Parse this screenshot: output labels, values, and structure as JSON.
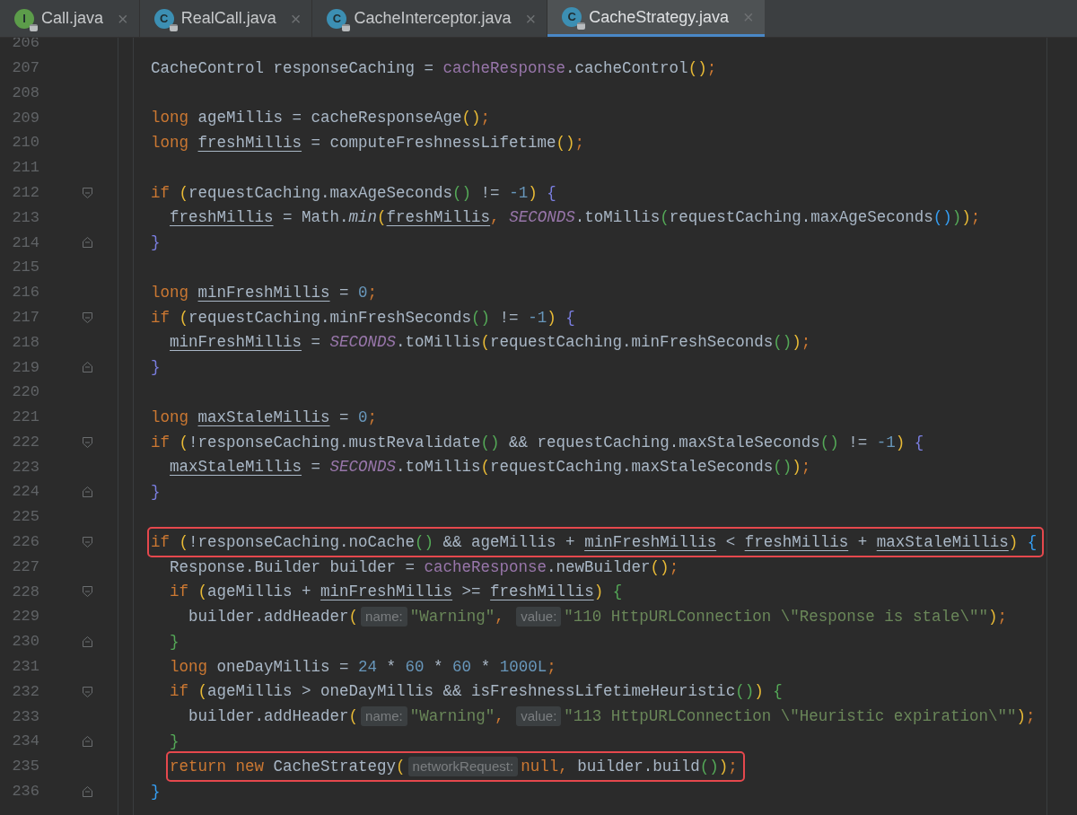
{
  "tabs": [
    {
      "interface": true,
      "icon_letter": "I",
      "label": "Call.java",
      "close": "×",
      "selected": false
    },
    {
      "interface": false,
      "icon_letter": "C",
      "label": "RealCall.java",
      "close": "×",
      "selected": false
    },
    {
      "interface": false,
      "icon_letter": "C",
      "label": "CacheInterceptor.java",
      "close": "×",
      "selected": false
    },
    {
      "interface": false,
      "icon_letter": "C",
      "label": "CacheStrategy.java",
      "close": "×",
      "selected": true
    }
  ],
  "lines": [
    {
      "number": "206"
    },
    {
      "number": "207",
      "tokens": [
        {
          "kind": "plain",
          "text": "CacheControl responseCaching = "
        },
        {
          "kind": "field",
          "text": "cacheResponse"
        },
        {
          "kind": "plain",
          "text": ".cacheControl"
        },
        {
          "kind": "b1",
          "text": "()"
        },
        {
          "kind": "punct",
          "text": ";"
        }
      ]
    },
    {
      "number": "208"
    },
    {
      "number": "209",
      "tokens": [
        {
          "kind": "kw",
          "text": "long "
        },
        {
          "kind": "plain",
          "text": "ageMillis = cacheResponseAge"
        },
        {
          "kind": "b1",
          "text": "()"
        },
        {
          "kind": "punct",
          "text": ";"
        }
      ]
    },
    {
      "number": "210",
      "tokens": [
        {
          "kind": "kw",
          "text": "long "
        },
        {
          "kind": "var",
          "text": "freshMillis"
        },
        {
          "kind": "plain",
          "text": " = computeFreshnessLifetime"
        },
        {
          "kind": "b1",
          "text": "()"
        },
        {
          "kind": "punct",
          "text": ";"
        }
      ]
    },
    {
      "number": "211"
    },
    {
      "number": "212",
      "fold_start": true,
      "tokens": [
        {
          "kind": "kw",
          "text": "if "
        },
        {
          "kind": "b1",
          "text": "("
        },
        {
          "kind": "plain",
          "text": "requestCaching.maxAgeSeconds"
        },
        {
          "kind": "b2",
          "text": "()"
        },
        {
          "kind": "plain",
          "text": " != "
        },
        {
          "kind": "num",
          "text": "-1"
        },
        {
          "kind": "b1",
          "text": ")"
        },
        {
          "kind": "b4",
          "text": " {"
        }
      ],
      "children": [
        {
          "number": "213",
          "tokens": [
            {
              "kind": "var",
              "text": "freshMillis"
            },
            {
              "kind": "plain",
              "text": " = Math."
            },
            {
              "kind": "static_call",
              "text": "min"
            },
            {
              "kind": "b1",
              "text": "("
            },
            {
              "kind": "var",
              "text": "freshMillis"
            },
            {
              "kind": "punct",
              "text": ", "
            },
            {
              "kind": "const",
              "text": "SECONDS"
            },
            {
              "kind": "plain",
              "text": ".toMillis"
            },
            {
              "kind": "b2",
              "text": "("
            },
            {
              "kind": "plain",
              "text": "requestCaching.maxAgeSeconds"
            },
            {
              "kind": "b3",
              "text": "()"
            },
            {
              "kind": "b2",
              "text": ")"
            },
            {
              "kind": "b1",
              "text": ")"
            },
            {
              "kind": "punct",
              "text": ";"
            }
          ]
        }
      ]
    },
    {
      "number": "214",
      "fold_end": true,
      "tokens": [
        {
          "kind": "b4",
          "text": "}"
        }
      ]
    },
    {
      "number": "215"
    },
    {
      "number": "216",
      "tokens": [
        {
          "kind": "kw",
          "text": "long "
        },
        {
          "kind": "var",
          "text": "minFreshMillis"
        },
        {
          "kind": "plain",
          "text": " = "
        },
        {
          "kind": "num",
          "text": "0"
        },
        {
          "kind": "punct",
          "text": ";"
        }
      ]
    },
    {
      "number": "217",
      "fold_start": true,
      "tokens": [
        {
          "kind": "kw",
          "text": "if "
        },
        {
          "kind": "b1",
          "text": "("
        },
        {
          "kind": "plain",
          "text": "requestCaching.minFreshSeconds"
        },
        {
          "kind": "b2",
          "text": "()"
        },
        {
          "kind": "plain",
          "text": " != "
        },
        {
          "kind": "num",
          "text": "-1"
        },
        {
          "kind": "b1",
          "text": ")"
        },
        {
          "kind": "b4",
          "text": " {"
        }
      ],
      "children": [
        {
          "number": "218",
          "tokens": [
            {
              "kind": "var",
              "text": "minFreshMillis"
            },
            {
              "kind": "plain",
              "text": " = "
            },
            {
              "kind": "const",
              "text": "SECONDS"
            },
            {
              "kind": "plain",
              "text": ".toMillis"
            },
            {
              "kind": "b1",
              "text": "("
            },
            {
              "kind": "plain",
              "text": "requestCaching.minFreshSeconds"
            },
            {
              "kind": "b2",
              "text": "()"
            },
            {
              "kind": "b1",
              "text": ")"
            },
            {
              "kind": "punct",
              "text": ";"
            }
          ]
        }
      ]
    },
    {
      "number": "219",
      "fold_end": true,
      "tokens": [
        {
          "kind": "b4",
          "text": "}"
        }
      ]
    },
    {
      "number": "220"
    },
    {
      "number": "221",
      "tokens": [
        {
          "kind": "kw",
          "text": "long "
        },
        {
          "kind": "var",
          "text": "maxStaleMillis"
        },
        {
          "kind": "plain",
          "text": " = "
        },
        {
          "kind": "num",
          "text": "0"
        },
        {
          "kind": "punct",
          "text": ";"
        }
      ]
    },
    {
      "number": "222",
      "fold_start": true,
      "tokens": [
        {
          "kind": "kw",
          "text": "if "
        },
        {
          "kind": "b1",
          "text": "("
        },
        {
          "kind": "plain",
          "text": "!responseCaching.mustRevalidate"
        },
        {
          "kind": "b2",
          "text": "()"
        },
        {
          "kind": "plain",
          "text": " && requestCaching.maxStaleSeconds"
        },
        {
          "kind": "b2",
          "text": "()"
        },
        {
          "kind": "plain",
          "text": " != "
        },
        {
          "kind": "num",
          "text": "-1"
        },
        {
          "kind": "b1",
          "text": ")"
        },
        {
          "kind": "b4",
          "text": " {"
        }
      ],
      "children": [
        {
          "number": "223",
          "tokens": [
            {
              "kind": "var",
              "text": "maxStaleMillis"
            },
            {
              "kind": "plain",
              "text": " = "
            },
            {
              "kind": "const",
              "text": "SECONDS"
            },
            {
              "kind": "plain",
              "text": ".toMillis"
            },
            {
              "kind": "b1",
              "text": "("
            },
            {
              "kind": "plain",
              "text": "requestCaching.maxStaleSeconds"
            },
            {
              "kind": "b2",
              "text": "()"
            },
            {
              "kind": "b1",
              "text": ")"
            },
            {
              "kind": "punct",
              "text": ";"
            }
          ]
        }
      ]
    },
    {
      "number": "224",
      "fold_end": true,
      "tokens": [
        {
          "kind": "b4",
          "text": "}"
        }
      ]
    },
    {
      "number": "225"
    },
    {
      "number": "226",
      "fold_start": true,
      "highlighted": true,
      "tokens": [
        {
          "kind": "kw",
          "text": "if "
        },
        {
          "kind": "b1",
          "text": "("
        },
        {
          "kind": "plain",
          "text": "!responseCaching.noCache"
        },
        {
          "kind": "b2",
          "text": "()"
        },
        {
          "kind": "plain",
          "text": " && ageMillis + "
        },
        {
          "kind": "var",
          "text": "minFreshMillis"
        },
        {
          "kind": "plain",
          "text": " < "
        },
        {
          "kind": "var",
          "text": "freshMillis"
        },
        {
          "kind": "plain",
          "text": " + "
        },
        {
          "kind": "var",
          "text": "maxStaleMillis"
        },
        {
          "kind": "b1",
          "text": ")"
        },
        {
          "kind": "b3",
          "text": " {"
        }
      ],
      "children": [
        {
          "number": "227",
          "tokens": [
            {
              "kind": "plain",
              "text": "Response.Builder builder = "
            },
            {
              "kind": "field",
              "text": "cacheResponse"
            },
            {
              "kind": "plain",
              "text": ".newBuilder"
            },
            {
              "kind": "b1",
              "text": "()"
            },
            {
              "kind": "punct",
              "text": ";"
            }
          ]
        },
        {
          "number": "228",
          "fold_start": true,
          "tokens": [
            {
              "kind": "kw",
              "text": "if "
            },
            {
              "kind": "b1",
              "text": "("
            },
            {
              "kind": "plain",
              "text": "ageMillis + "
            },
            {
              "kind": "var",
              "text": "minFreshMillis"
            },
            {
              "kind": "plain",
              "text": " >= "
            },
            {
              "kind": "var",
              "text": "freshMillis"
            },
            {
              "kind": "b1",
              "text": ")"
            },
            {
              "kind": "b2",
              "text": " {"
            }
          ],
          "children": [
            {
              "number": "229",
              "tokens": [
                {
                  "kind": "plain",
                  "text": "builder.addHeader"
                },
                {
                  "kind": "b1",
                  "text": "("
                },
                {
                  "kind": "hint",
                  "text": "name:"
                },
                {
                  "kind": "str",
                  "text": "\"Warning\""
                },
                {
                  "kind": "punct",
                  "text": ", "
                },
                {
                  "kind": "hint",
                  "text": "value:"
                },
                {
                  "kind": "str",
                  "text": "\"110 HttpURLConnection \\\"Response is stale\\\"\""
                },
                {
                  "kind": "b1",
                  "text": ")"
                },
                {
                  "kind": "punct",
                  "text": ";"
                }
              ]
            }
          ]
        },
        {
          "number": "230",
          "fold_end": true,
          "tokens": [
            {
              "kind": "b2",
              "text": "}"
            }
          ]
        },
        {
          "number": "231",
          "tokens": [
            {
              "kind": "kw",
              "text": "long "
            },
            {
              "kind": "plain",
              "text": "oneDayMillis = "
            },
            {
              "kind": "num",
              "text": "24"
            },
            {
              "kind": "plain",
              "text": " * "
            },
            {
              "kind": "num",
              "text": "60"
            },
            {
              "kind": "plain",
              "text": " * "
            },
            {
              "kind": "num",
              "text": "60"
            },
            {
              "kind": "plain",
              "text": " * "
            },
            {
              "kind": "num",
              "text": "1000L"
            },
            {
              "kind": "punct",
              "text": ";"
            }
          ]
        },
        {
          "number": "232",
          "fold_start": true,
          "tokens": [
            {
              "kind": "kw",
              "text": "if "
            },
            {
              "kind": "b1",
              "text": "("
            },
            {
              "kind": "plain",
              "text": "ageMillis > oneDayMillis && isFreshnessLifetimeHeuristic"
            },
            {
              "kind": "b2",
              "text": "()"
            },
            {
              "kind": "b1",
              "text": ")"
            },
            {
              "kind": "b2",
              "text": " {"
            }
          ],
          "children": [
            {
              "number": "233",
              "tokens": [
                {
                  "kind": "plain",
                  "text": "builder.addHeader"
                },
                {
                  "kind": "b1",
                  "text": "("
                },
                {
                  "kind": "hint",
                  "text": "name:"
                },
                {
                  "kind": "str",
                  "text": "\"Warning\""
                },
                {
                  "kind": "punct",
                  "text": ", "
                },
                {
                  "kind": "hint",
                  "text": "value:"
                },
                {
                  "kind": "str",
                  "text": "\"113 HttpURLConnection \\\"Heuristic expiration\\\"\""
                },
                {
                  "kind": "b1",
                  "text": ")"
                },
                {
                  "kind": "punct",
                  "text": ";"
                }
              ]
            }
          ]
        },
        {
          "number": "234",
          "fold_end": true,
          "tokens": [
            {
              "kind": "b2",
              "text": "}"
            }
          ]
        },
        {
          "number": "235",
          "highlighted": true,
          "tokens": [
            {
              "kind": "kw",
              "text": "return new "
            },
            {
              "kind": "plain",
              "text": "CacheStrategy"
            },
            {
              "kind": "b1",
              "text": "("
            },
            {
              "kind": "hint",
              "text": "networkRequest:"
            },
            {
              "kind": "kw",
              "text": "null"
            },
            {
              "kind": "punct",
              "text": ", "
            },
            {
              "kind": "plain",
              "text": "builder.build"
            },
            {
              "kind": "b2",
              "text": "()"
            },
            {
              "kind": "b1",
              "text": ")"
            },
            {
              "kind": "punct",
              "text": ";"
            }
          ]
        }
      ]
    },
    {
      "number": "236",
      "fold_end": true,
      "tokens": [
        {
          "kind": "b3",
          "text": "}"
        }
      ]
    }
  ]
}
